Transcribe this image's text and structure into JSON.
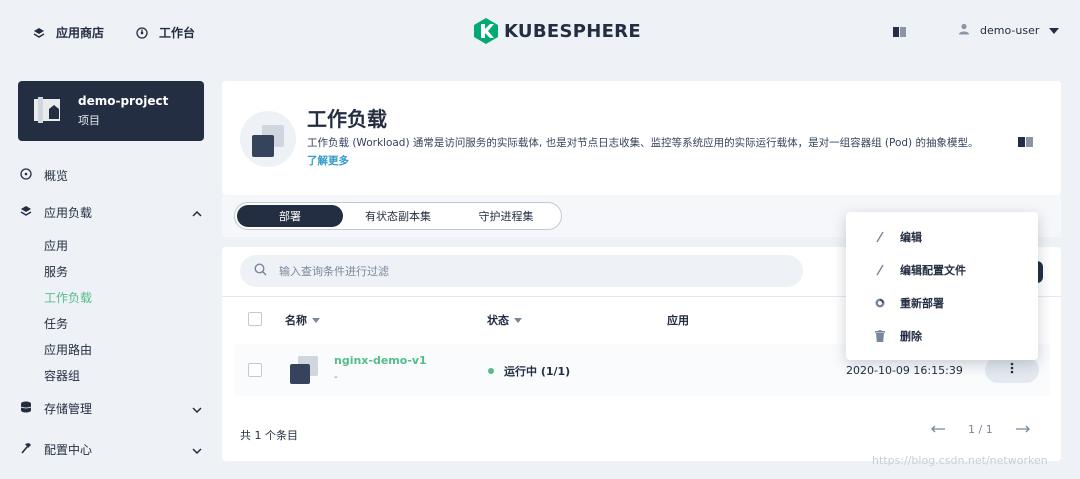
{
  "topbar": {
    "app_store": "应用商店",
    "workbench": "工作台",
    "logo_text": "KUBESPHERE",
    "user_name": "demo-user"
  },
  "sidebar": {
    "project": {
      "name": "demo-project",
      "type": "项目"
    },
    "overview": "概览",
    "app_workloads": "应用负载",
    "sub_items": [
      "应用",
      "服务",
      "工作负载",
      "任务",
      "应用路由",
      "容器组"
    ],
    "active_sub": "工作负载",
    "storage": "存储管理",
    "config": "配置中心"
  },
  "header": {
    "title": "工作负载",
    "description": "工作负载 (Workload) 通常是访问服务的实际载体, 也是对节点日志收集、监控等系统应用的实际运行载体，是对一组容器组 (Pod) 的抽象模型。",
    "learn_more": "了解更多"
  },
  "tabs": [
    {
      "label": "部署",
      "active": true
    },
    {
      "label": "有状态副本集",
      "active": false
    },
    {
      "label": "守护进程集",
      "active": false
    }
  ],
  "search": {
    "placeholder": "输入查询条件进行过滤"
  },
  "table": {
    "columns": {
      "name": "名称",
      "status": "状态",
      "app": "应用"
    },
    "rows": [
      {
        "name": "nginx-demo-v1",
        "sub": "-",
        "status": "运行中 (1/1)",
        "updated": "2020-10-09 16:15:39"
      }
    ]
  },
  "footer": {
    "total": "共 1 个条目",
    "page": "1 / 1"
  },
  "menu": {
    "items": [
      "编辑",
      "编辑配置文件",
      "重新部署",
      "删除"
    ]
  },
  "watermark": "https://blog.csdn.net/networken",
  "colors": {
    "primary": "#242e42",
    "accent": "#55bc8a",
    "link": "#329dce",
    "background": "#eef2f6"
  }
}
